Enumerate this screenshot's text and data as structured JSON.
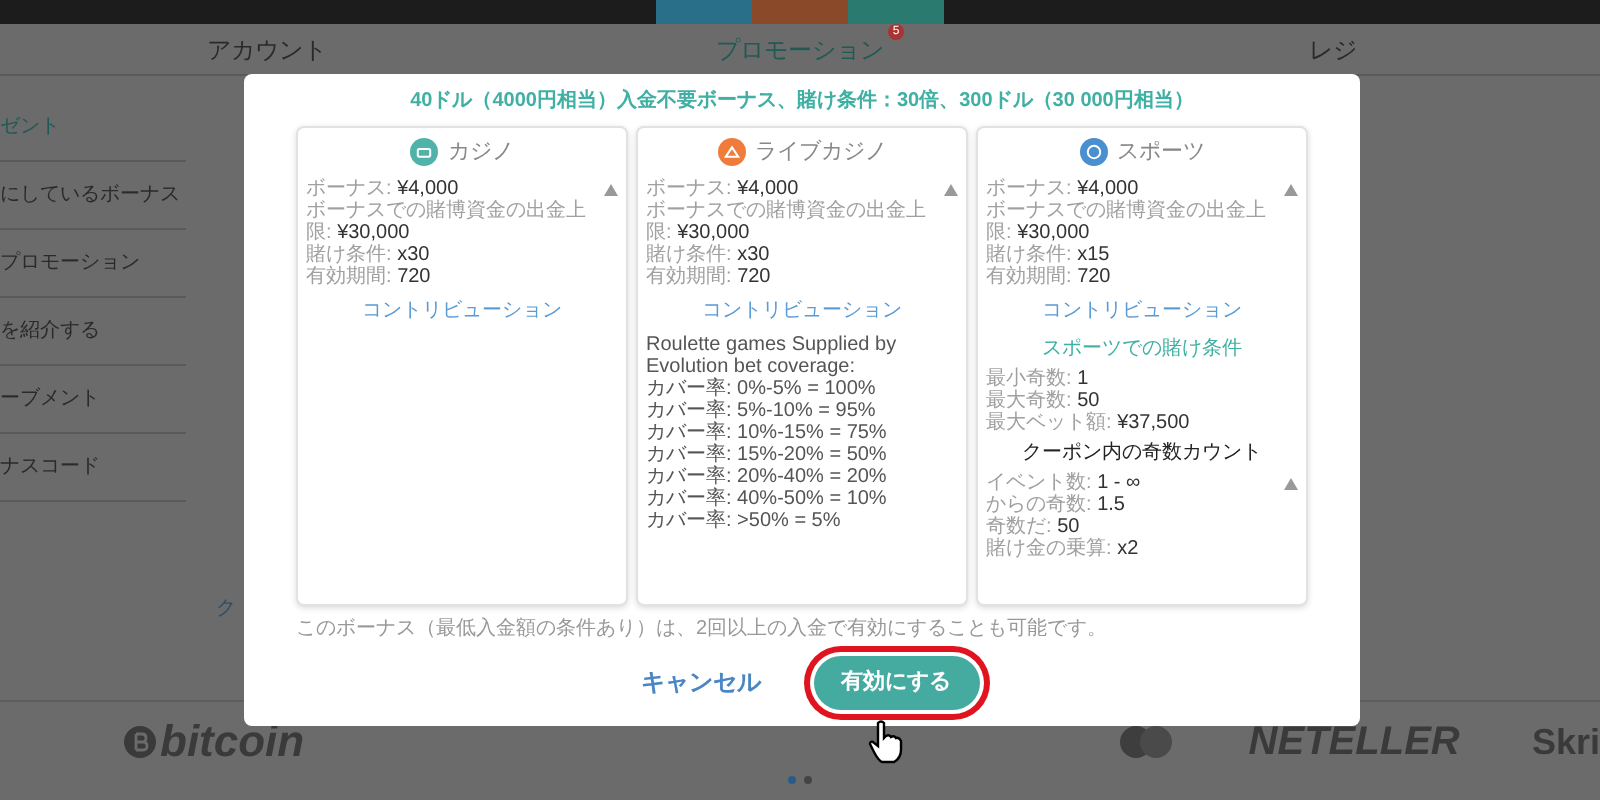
{
  "nav": {
    "tabs": [
      {
        "label": "アカウント",
        "selected": false
      },
      {
        "label": "プロモーション",
        "selected": true,
        "badge": "5"
      },
      {
        "label": "レジ",
        "selected": false
      }
    ]
  },
  "sidebar": {
    "items": [
      {
        "label": "ゼント",
        "selected": true
      },
      {
        "label": "にしているボーナス",
        "selected": false
      },
      {
        "label": "プロモーション",
        "selected": false
      },
      {
        "label": "を紹介する",
        "selected": false
      },
      {
        "label": "ーブメント",
        "selected": false
      },
      {
        "label": "ナスコード",
        "selected": false
      }
    ]
  },
  "behind_text": "ク",
  "footer": {
    "logos": [
      {
        "kind": "bitcoin",
        "text": "bitcoin"
      },
      {
        "kind": "cards"
      },
      {
        "kind": "neteller",
        "text": "NETELLER"
      },
      {
        "kind": "skrill",
        "text": "Skri"
      }
    ],
    "dots": [
      {
        "selected": true
      },
      {
        "selected": false
      }
    ]
  },
  "modal": {
    "title": "40ドル（4000円相当）入金不要ボーナス、賭け条件：30倍、300ドル（30 000円相当）",
    "cards": [
      {
        "name": "カジノ",
        "color": "#4fb3a9",
        "blocks": [
          {
            "kind": "rows",
            "collapsible": true,
            "rows": [
              {
                "label": "ボーナス:",
                "value": "¥4,000"
              },
              {
                "label": "ボーナスでの賭博資金の出金上限:",
                "value": "¥30,000"
              },
              {
                "label": "賭け条件:",
                "value": "x30"
              },
              {
                "label": "有効期間:",
                "value": "720"
              }
            ]
          },
          {
            "kind": "link",
            "text": "コントリビューション"
          }
        ]
      },
      {
        "name": "ライブカジノ",
        "color": "#f07c3c",
        "blocks": [
          {
            "kind": "rows",
            "collapsible": true,
            "rows": [
              {
                "label": "ボーナス:",
                "value": "¥4,000"
              },
              {
                "label": "ボーナスでの賭博資金の出金上限:",
                "value": "¥30,000"
              },
              {
                "label": "賭け条件:",
                "value": "x30"
              },
              {
                "label": "有効期間:",
                "value": "720"
              }
            ]
          },
          {
            "kind": "link",
            "text": "コントリビューション"
          },
          {
            "kind": "text",
            "lines": [
              "Roulette games Supplied by Evolution bet coverage:",
              "カバー率: 0%-5% = 100%",
              "カバー率: 5%-10% = 95%",
              "カバー率: 10%-15% = 75%",
              "カバー率: 15%-20% = 50%",
              "カバー率: 20%-40% = 20%",
              "カバー率: 40%-50% = 10%",
              "カバー率: >50% = 5%"
            ]
          }
        ]
      },
      {
        "name": "スポーツ",
        "color": "#4a90d0",
        "blocks": [
          {
            "kind": "rows",
            "collapsible": true,
            "rows": [
              {
                "label": "ボーナス:",
                "value": "¥4,000"
              },
              {
                "label": "ボーナスでの賭博資金の出金上限:",
                "value": "¥30,000"
              },
              {
                "label": "賭け条件:",
                "value": "x15"
              },
              {
                "label": "有効期間:",
                "value": "720"
              }
            ]
          },
          {
            "kind": "link",
            "text": "コントリビューション"
          },
          {
            "kind": "subheading",
            "text": "スポーツでの賭け条件"
          },
          {
            "kind": "rows",
            "collapsible": false,
            "rows": [
              {
                "label": "最小奇数:",
                "value": "1"
              },
              {
                "label": "最大奇数:",
                "value": "50"
              },
              {
                "label": "最大ベット額:",
                "value": "¥37,500"
              }
            ]
          },
          {
            "kind": "heading",
            "text": "クーポン内の奇数カウント"
          },
          {
            "kind": "rows",
            "collapsible": true,
            "rows": [
              {
                "label": "イベント数:",
                "value": "1 - ∞"
              },
              {
                "label": "からの奇数:",
                "value": "1.5"
              },
              {
                "label": "奇数だ:",
                "value": "50"
              },
              {
                "label": "賭け金の乗算:",
                "value": "x2"
              }
            ]
          }
        ]
      }
    ],
    "note": "このボーナス（最低入金額の条件あり）は、2回以上の入金で有効にすることも可能です。",
    "buttons": [
      {
        "kind": "text",
        "label": "キャンセル",
        "highlighted": false
      },
      {
        "kind": "primary",
        "label": "有効にする",
        "highlighted": true
      }
    ]
  }
}
